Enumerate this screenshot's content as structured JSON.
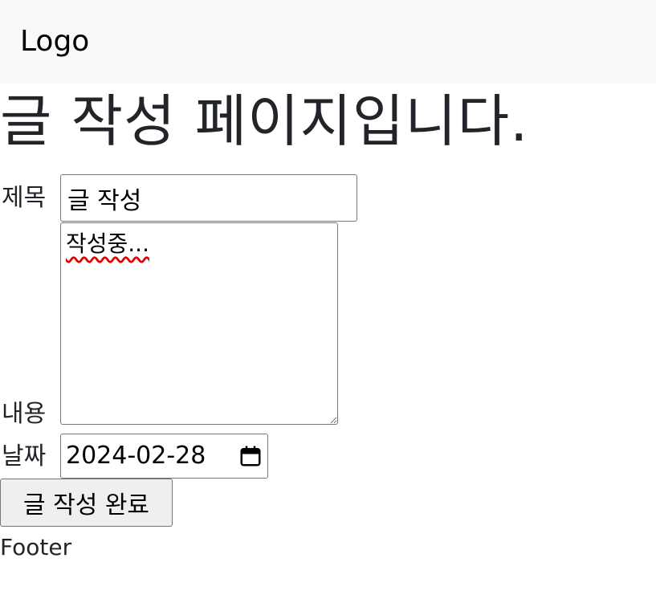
{
  "navbar": {
    "logo": "Logo"
  },
  "page": {
    "title": "글 작성 페이지입니다."
  },
  "form": {
    "title_label": "제목",
    "title_value": "글 작성",
    "content_label": "내용",
    "content_value": "작성중...",
    "date_label": "날짜",
    "date_value": "2024-02-28",
    "submit_label": "글 작성 완료"
  },
  "footer": {
    "text": "Footer"
  },
  "icons": {
    "calendar": "calendar-icon"
  }
}
